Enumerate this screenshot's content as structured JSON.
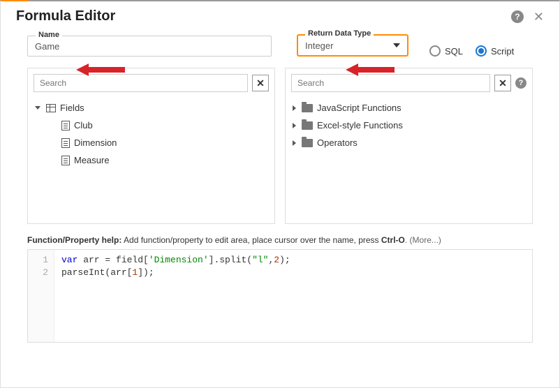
{
  "title": "Formula Editor",
  "nameField": {
    "label": "Name",
    "value": "Game"
  },
  "returnType": {
    "label": "Return Data Type",
    "value": "Integer"
  },
  "mode": {
    "sql": "SQL",
    "script": "Script",
    "selected": "script"
  },
  "leftPanel": {
    "searchPlaceholder": "Search",
    "root": "Fields",
    "items": [
      "Club",
      "Dimension",
      "Measure"
    ]
  },
  "rightPanel": {
    "searchPlaceholder": "Search",
    "items": [
      "JavaScript Functions",
      "Excel-style Functions",
      "Operators"
    ]
  },
  "help": {
    "label": "Function/Property help:",
    "text": "Add function/property to edit area, place cursor over the name, press ",
    "shortcut": "Ctrl-O",
    "more": ". (More...)"
  },
  "code": {
    "lines": [
      "1",
      "2"
    ],
    "line1_parts": {
      "kw": "var",
      "t1": " arr = field[",
      "s1": "'Dimension'",
      "t2": "].split(",
      "s2": "\"l\"",
      "t3": ",",
      "n1": "2",
      "t4": ");"
    },
    "line2_parts": {
      "t1": "parseInt(arr[",
      "n1": "1",
      "t2": "]);"
    }
  }
}
